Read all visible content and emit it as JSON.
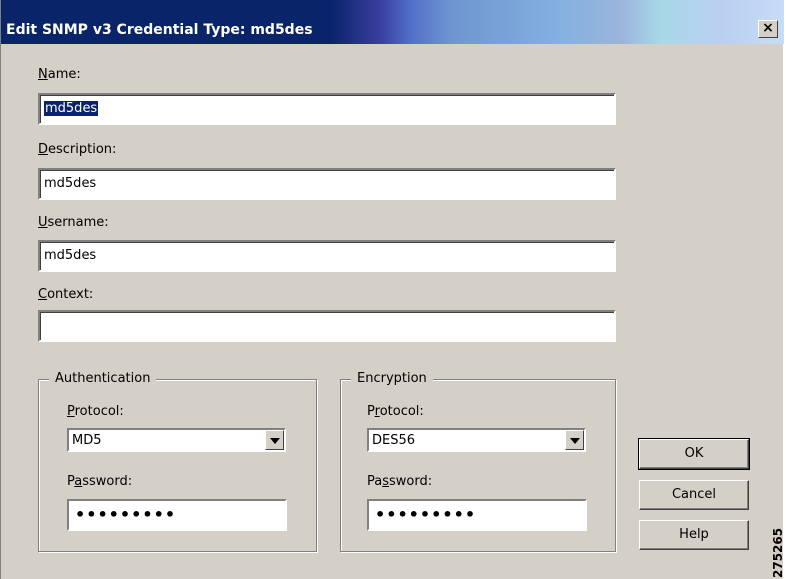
{
  "window": {
    "title": "Edit SNMP v3 Credential Type: md5des",
    "close_glyph": "×"
  },
  "form": {
    "name_label_u": "N",
    "name_label_rest": "ame:",
    "name_value": "md5des",
    "description_label_u": "D",
    "description_label_rest": "escription:",
    "description_value": "md5des",
    "username_label_u": "U",
    "username_label_rest": "sername:",
    "username_value": "md5des",
    "context_label_u": "C",
    "context_label_rest": "ontext:",
    "context_value": ""
  },
  "authentication": {
    "legend": "Authentication",
    "protocol_label_u": "P",
    "protocol_label_rest": "rotocol:",
    "protocol_value": "MD5",
    "password_label_pre": "P",
    "password_label_u": "a",
    "password_label_rest": "ssword:",
    "password_mask": "•••••••••"
  },
  "encryption": {
    "legend": "Encryption",
    "protocol_label_pre": "P",
    "protocol_label_u": "r",
    "protocol_label_rest": "otocol:",
    "protocol_value": "DES56",
    "password_label_pre": "Pa",
    "password_label_u": "s",
    "password_label_rest": "sword:",
    "password_mask": "•••••••••"
  },
  "buttons": {
    "ok": "OK",
    "cancel": "Cancel",
    "help": "Help"
  },
  "figure_number": "275265"
}
